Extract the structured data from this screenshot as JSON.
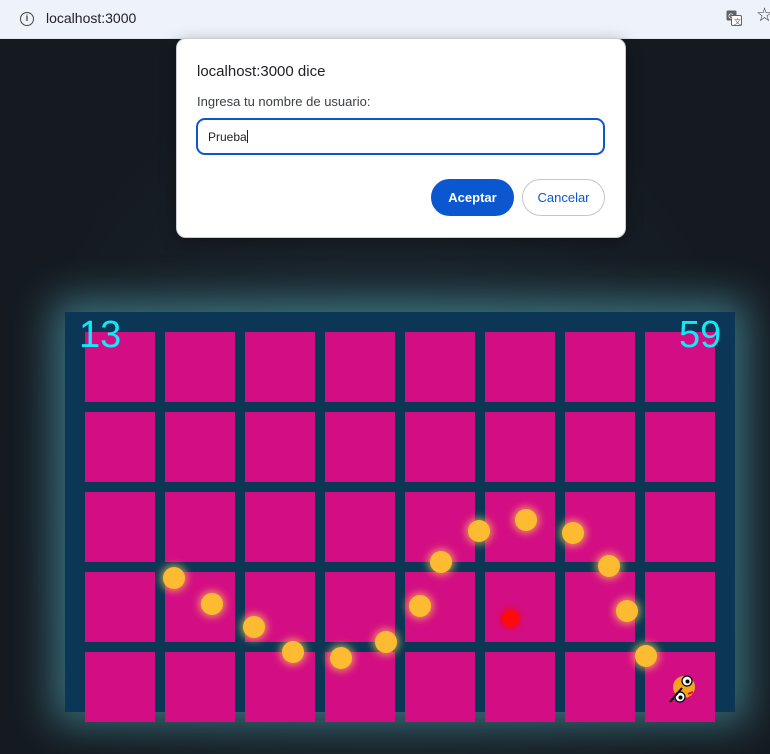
{
  "browser": {
    "url": "localhost:3000",
    "icons": [
      "info-icon",
      "translate-icon",
      "star-icon"
    ]
  },
  "game": {
    "score_left": "13",
    "score_right": "59",
    "grid": {
      "rows": 5,
      "cols": 8
    },
    "colors": {
      "board": "#0c3656",
      "cell": "#d30e84",
      "score": "#15e8f5",
      "ball": "#fdbb32",
      "red_dot": "#ff0a0a"
    },
    "trail_ball_count": 14
  },
  "dialog": {
    "title": "localhost:3000 dice",
    "message": "Ingresa tu nombre de usuario:",
    "input_value": "Prueba",
    "ok_label": "Aceptar",
    "cancel_label": "Cancelar",
    "accent": "#0b57d0"
  }
}
